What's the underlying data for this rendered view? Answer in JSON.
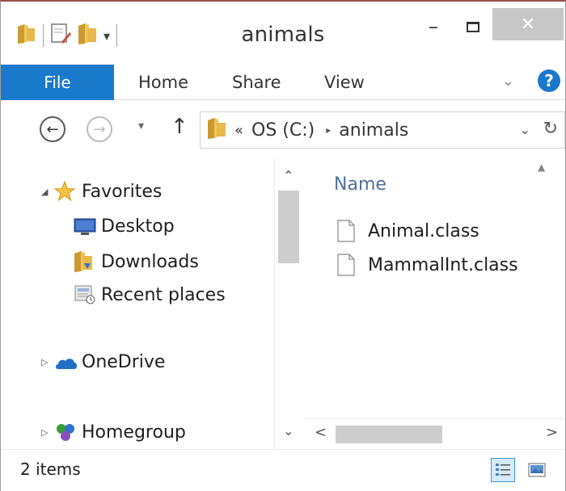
{
  "window": {
    "title": "animals"
  },
  "quick_access": {
    "icons": [
      "folder-icon",
      "properties-icon",
      "new-folder-icon",
      "customize-dropdown-icon"
    ],
    "dropdown_glyph": "▾"
  },
  "title_controls": {
    "minimize": "–",
    "close": "✕"
  },
  "ribbon": {
    "tabs": [
      {
        "label": "File",
        "active": true
      },
      {
        "label": "Home"
      },
      {
        "label": "Share"
      },
      {
        "label": "View"
      }
    ],
    "expand_glyph": "⌄",
    "help_glyph": "?"
  },
  "navigation": {
    "back_glyph": "←",
    "forward_glyph": "→",
    "recent_glyph": "▾",
    "up_glyph": "↑",
    "address": {
      "overflow_glyph": "«",
      "segments": [
        "OS (C:)",
        "animals"
      ],
      "separator_glyph": "▸",
      "dropdown_glyph": "⌄",
      "refresh_glyph": "↻"
    }
  },
  "nav_pane": {
    "items": [
      {
        "label": "Favorites",
        "icon": "star-icon",
        "expander": "◢"
      },
      {
        "label": "Desktop",
        "icon": "desktop-icon"
      },
      {
        "label": "Downloads",
        "icon": "downloads-icon"
      },
      {
        "label": "Recent places",
        "icon": "recent-places-icon"
      },
      {
        "label": "OneDrive",
        "icon": "onedrive-icon",
        "expander": "▷"
      },
      {
        "label": "Homegroup",
        "icon": "homegroup-icon",
        "expander": "▷"
      }
    ],
    "scroll_up_glyph": "⌃",
    "scroll_down_glyph": "⌄"
  },
  "files": {
    "column_header": "Name",
    "sort_glyph": "▲",
    "rows": [
      {
        "name": "Animal.class",
        "icon": "file-icon"
      },
      {
        "name": "MammalInt.class",
        "icon": "file-icon"
      }
    ],
    "scroll_left_glyph": "<",
    "scroll_right_glyph": ">"
  },
  "status": {
    "item_count": "2 items",
    "views": [
      "details-view-icon",
      "large-icons-view-icon"
    ]
  },
  "colors": {
    "accent": "#1979ca",
    "folder": "#e8b84a",
    "close_button": "#c7c7c7",
    "column_header": "#4b6fa0"
  }
}
